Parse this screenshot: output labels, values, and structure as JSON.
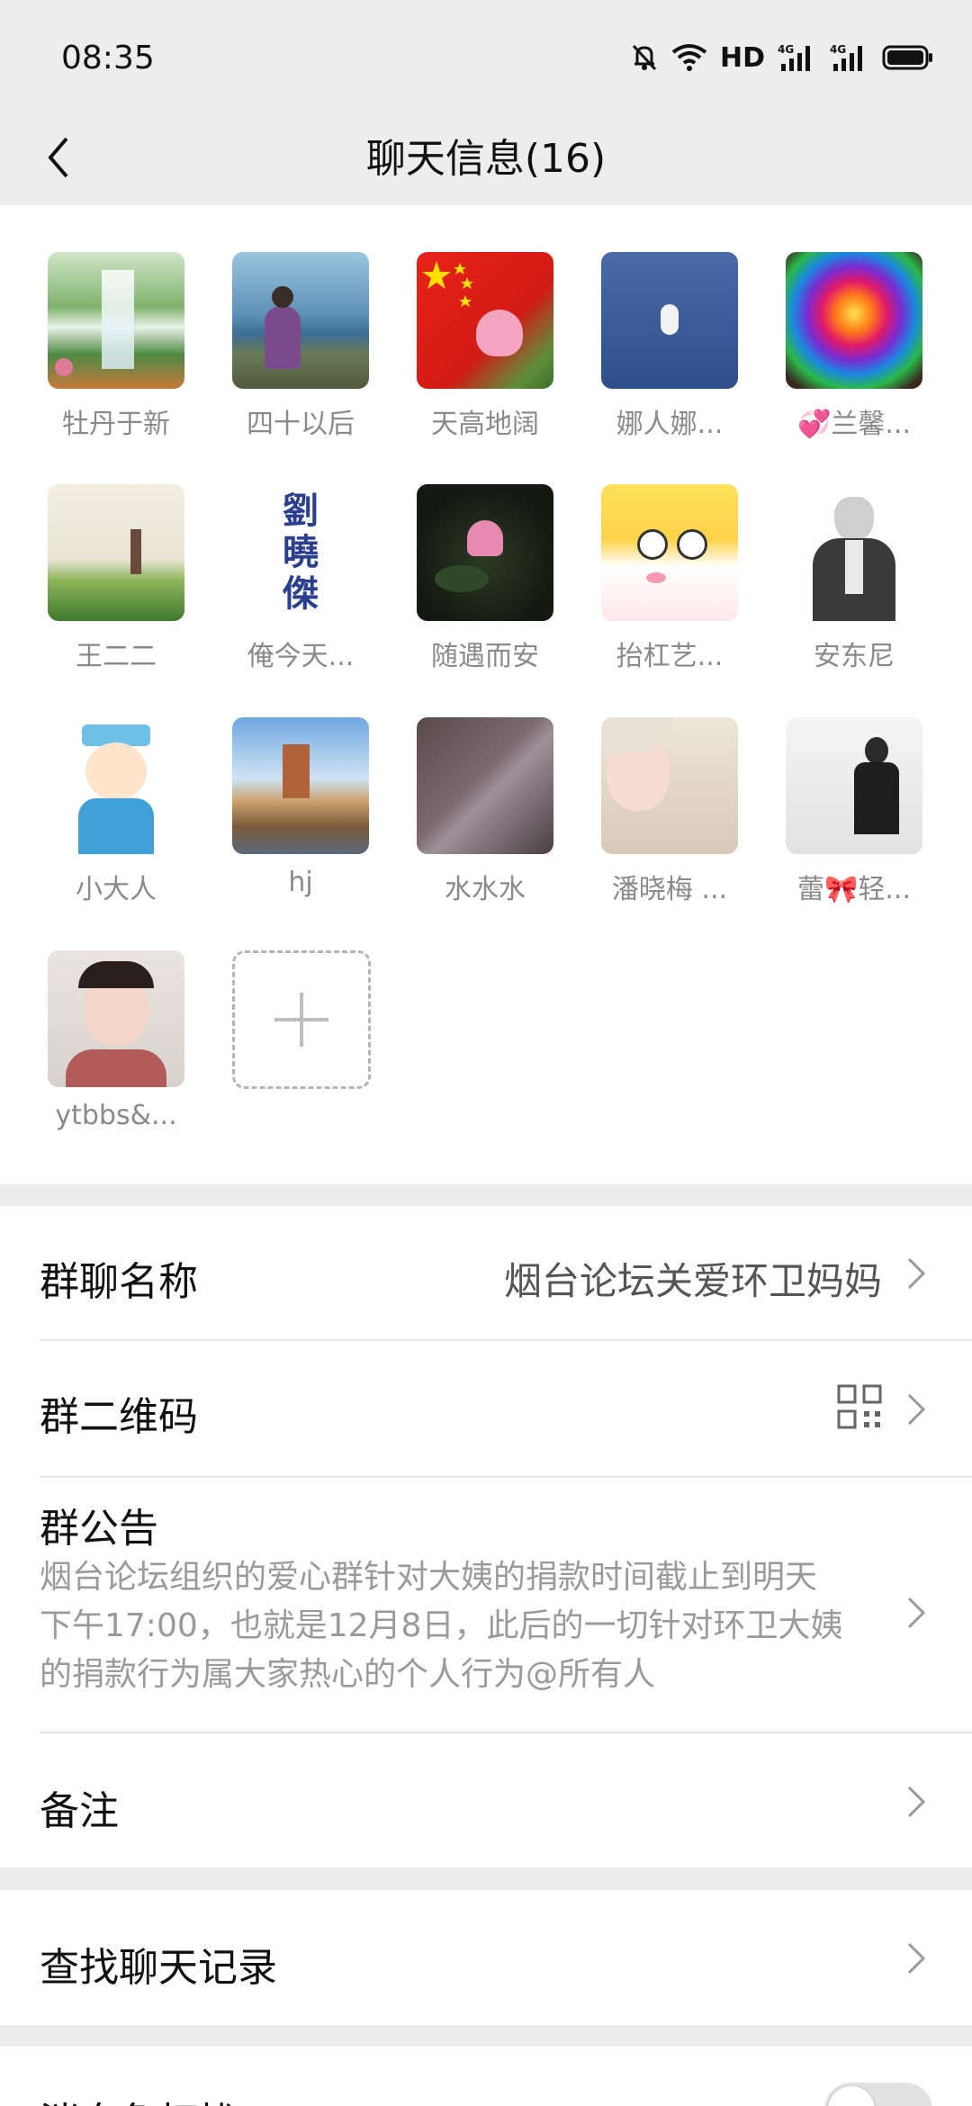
{
  "status_bar": {
    "time": "08:35",
    "network_label": "HD",
    "icons": [
      "bell-off-icon",
      "wifi-icon",
      "signal-4g-icon",
      "signal-4g-icon",
      "battery-icon"
    ]
  },
  "header": {
    "title": "聊天信息(16)",
    "back_icon": "chevron-left-icon"
  },
  "members": [
    {
      "name": "牡丹于新"
    },
    {
      "name": "四十以后"
    },
    {
      "name": "天高地阔"
    },
    {
      "name": "娜人娜..."
    },
    {
      "name": "💞兰馨..."
    },
    {
      "name": "王二二"
    },
    {
      "name": "俺今天..."
    },
    {
      "name": "随遇而安"
    },
    {
      "name": "抬杠艺..."
    },
    {
      "name": "安东尼"
    },
    {
      "name": "小大人"
    },
    {
      "name": "hj"
    },
    {
      "name": "水水水"
    },
    {
      "name": "潘晓梅 ..."
    },
    {
      "name": "蕾🎀轻..."
    },
    {
      "name": "ytbbs&..."
    }
  ],
  "avatar_texts": {
    "calligraphy": [
      "劉",
      "曉",
      "傑"
    ]
  },
  "settings": {
    "group_name_label": "群聊名称",
    "group_name_value": "烟台论坛关爱环卫妈妈",
    "qr_label": "群二维码",
    "notice_label": "群公告",
    "notice_lines": [
      "烟台论坛组织的爱心群针对大姨的捐款时间截止到明天",
      "下午17:00，也就是12月8日，此后的一切针对环卫大姨",
      "的捐款行为属大家热心的个人行为@所有人"
    ],
    "remark_label": "备注",
    "search_label": "查找聊天记录",
    "mute_label": "消息免打扰"
  },
  "colors": {
    "background": "#ededed",
    "card": "#ffffff",
    "secondary_text": "#8a8a8a"
  }
}
